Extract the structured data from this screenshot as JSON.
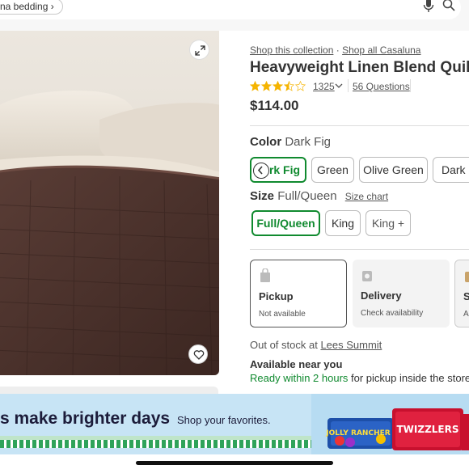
{
  "search": {
    "chip_label": "na bedding",
    "chip_chevron": "›"
  },
  "links": {
    "collection": "Shop this collection",
    "separator": " · ",
    "all": "Shop all Casaluna"
  },
  "product": {
    "title": "Heavyweight Linen Blend Quilt -",
    "rating_value": 3.5,
    "rating_count": "1325",
    "questions": "56 Questions",
    "price": "$114.00"
  },
  "color": {
    "label": "Color",
    "selected": "Dark Fig",
    "options": [
      "Dark Fig",
      "Green",
      "Olive Green",
      "Dark C"
    ],
    "first_visible_text": "rk Fig"
  },
  "size": {
    "label": "Size",
    "selected": "Full/Queen",
    "size_chart": "Size chart",
    "options": [
      "Full/Queen",
      "King",
      "King +"
    ]
  },
  "fulfillment": {
    "pickup": {
      "title": "Pickup",
      "status": "Not available"
    },
    "delivery": {
      "title": "Delivery",
      "status": "Check availability"
    },
    "shipping": {
      "title": "S",
      "status": "Ar"
    }
  },
  "store": {
    "out_of_stock_prefix": "Out of stock at ",
    "store_name": "Lees Summit",
    "available_near": "Available near you",
    "ready_green": "Ready within 2 hours",
    "ready_rest": " for pickup inside the store"
  },
  "banner": {
    "headline": "s make brighter days",
    "subtext": "Shop your favorites.",
    "product_brand_1": "JOLLY RANCHER",
    "product_brand_2": "TWIZZLERS"
  },
  "colors": {
    "accent_green": "#108a2f",
    "star": "#f5b400",
    "banner_bg": "#c7e4f5"
  },
  "icons": [
    "microphone-icon",
    "search-icon",
    "expand-icon",
    "heart-icon",
    "chevron-down-icon",
    "chevron-left-icon",
    "store-icon",
    "package-icon"
  ]
}
